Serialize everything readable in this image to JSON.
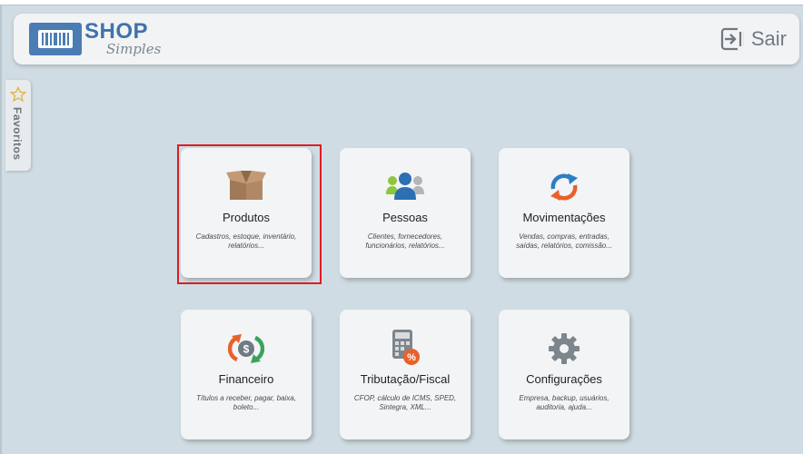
{
  "header": {
    "logo_main": "SHOP",
    "logo_sub": "Simples",
    "exit_label": "Sair"
  },
  "sidebar": {
    "favorites_label": "Favoritos"
  },
  "modules": [
    {
      "title": "Produtos",
      "desc": "Cadastros, estoque, inventário, relatórios...",
      "icon": "box-icon",
      "selected": true
    },
    {
      "title": "Pessoas",
      "desc": "Clientes, fornecedores, funcionários, relatórios...",
      "icon": "people-icon"
    },
    {
      "title": "Movimentações",
      "desc": "Vendas, compras, entradas, saídas, relatórios, comissão...",
      "icon": "sync-arrows-icon"
    },
    {
      "title": "Financeiro",
      "desc": "Títulos a receber, pagar, baixa, boleto...",
      "icon": "money-cycle-icon"
    },
    {
      "title": "Tributação/Fiscal",
      "desc": "CFOP, cálculo de ICMS, SPED, Sintegra, XML...",
      "icon": "calculator-percent-icon"
    },
    {
      "title": "Configurações",
      "desc": "Empresa, backup, usuários, auditoria, ajuda...",
      "icon": "gear-icon"
    }
  ],
  "colors": {
    "background": "#cfdce3",
    "brand": "#3f73ad",
    "highlight": "#e01b23",
    "people_blue": "#2d6fb3",
    "people_green": "#8dc63f",
    "sync_blue": "#2b7fc4",
    "sync_orange": "#e8612c"
  }
}
